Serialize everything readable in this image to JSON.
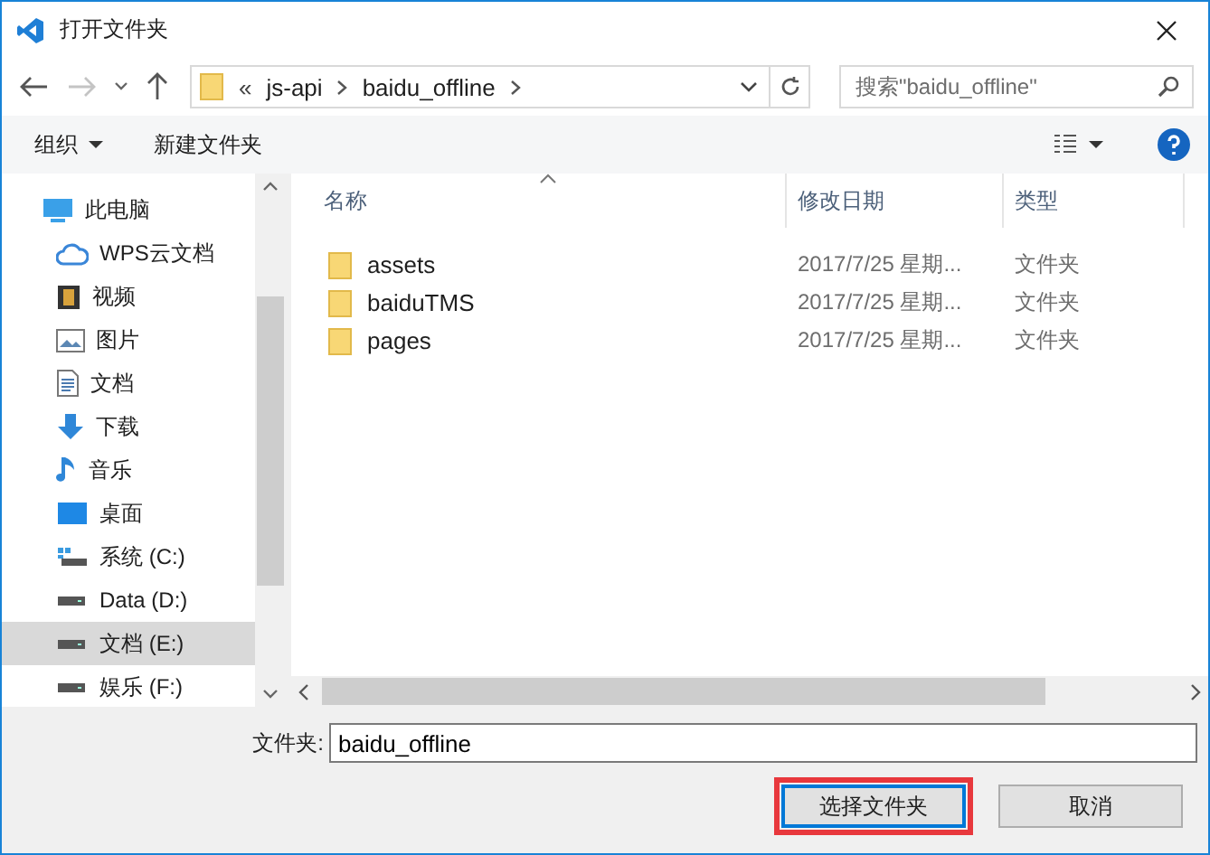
{
  "window": {
    "title": "打开文件夹"
  },
  "address": {
    "overflow": "«",
    "crumbs": [
      "js-api",
      "baidu_offline"
    ]
  },
  "search": {
    "placeholder": "搜索\"baidu_offline\""
  },
  "toolbar": {
    "organize": "组织",
    "new_folder": "新建文件夹"
  },
  "sidebar": {
    "items": [
      {
        "label": "此电脑",
        "kind": "pc",
        "selected": false,
        "children": [
          {
            "label": "WPS云文档",
            "kind": "cloud",
            "selected": false
          },
          {
            "label": "视频",
            "kind": "video",
            "selected": false
          },
          {
            "label": "图片",
            "kind": "picture",
            "selected": false
          },
          {
            "label": "文档",
            "kind": "document",
            "selected": false
          },
          {
            "label": "下载",
            "kind": "download",
            "selected": false
          },
          {
            "label": "音乐",
            "kind": "music",
            "selected": false
          },
          {
            "label": "桌面",
            "kind": "desktop",
            "selected": false
          },
          {
            "label": "系统 (C:)",
            "kind": "system-drive",
            "selected": false
          },
          {
            "label": "Data (D:)",
            "kind": "drive",
            "selected": false
          },
          {
            "label": "文档 (E:)",
            "kind": "drive",
            "selected": true
          },
          {
            "label": "娱乐 (F:)",
            "kind": "drive",
            "selected": false
          }
        ]
      }
    ]
  },
  "table": {
    "columns": [
      {
        "label": "名称",
        "sorted": true
      },
      {
        "label": "修改日期",
        "sorted": false
      },
      {
        "label": "类型",
        "sorted": false
      }
    ],
    "rows": [
      {
        "name": "assets",
        "date": "2017/7/25 星期...",
        "type": "文件夹"
      },
      {
        "name": "baiduTMS",
        "date": "2017/7/25 星期...",
        "type": "文件夹"
      },
      {
        "name": "pages",
        "date": "2017/7/25 星期...",
        "type": "文件夹"
      }
    ]
  },
  "footer": {
    "label": "文件夹:",
    "value": "baidu_offline",
    "buttons": [
      {
        "label": "选择文件夹",
        "kind": "primary",
        "highlighted": true
      },
      {
        "label": "取消",
        "kind": "secondary",
        "highlighted": false
      }
    ]
  }
}
